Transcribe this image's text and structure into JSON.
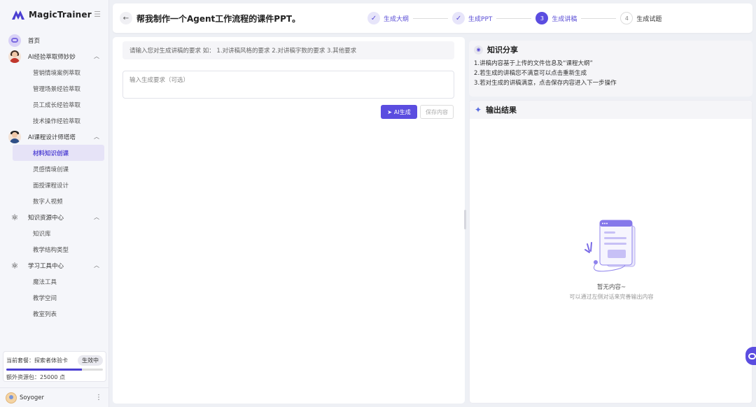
{
  "app": {
    "name": "MagicTrainer"
  },
  "sidebar": {
    "home": "首页",
    "groups": [
      {
        "label": "AI经验萃取师妙妙",
        "items": [
          "营销情境案例萃取",
          "管理场景经验萃取",
          "员工成长经验萃取",
          "技术操作经验萃取"
        ]
      },
      {
        "label": "AI课程设计师塔塔",
        "items": [
          "材料知识创课",
          "灵感情境创课",
          "面授课程设计",
          "数字人视频"
        ]
      },
      {
        "label": "知识资源中心",
        "items": [
          "知识库",
          "教学结构类型"
        ]
      },
      {
        "label": "学习工具中心",
        "items": [
          "魔法工具",
          "教学空间",
          "教室列表"
        ]
      }
    ],
    "active_item": "材料知识创课",
    "plan": {
      "label": "当前套餐：探索者体验卡",
      "badge": "生效中",
      "progress": 0.78,
      "extra": "额外资源包：25000 点"
    },
    "user": {
      "name": "Soyoger"
    }
  },
  "header": {
    "title": "帮我制作一个Agent工作流程的课件PPT。",
    "steps": [
      {
        "index": "1",
        "label": "生成大纲",
        "state": "done"
      },
      {
        "index": "2",
        "label": "生成PPT",
        "state": "done"
      },
      {
        "index": "3",
        "label": "生成讲稿",
        "state": "current"
      },
      {
        "index": "4",
        "label": "生成试题",
        "state": "todo"
      }
    ]
  },
  "left": {
    "hint": "请输入您对生成讲稿的要求 如： 1.对讲稿风格的要求 2.对讲稿字数的要求 3.其他要求",
    "input_placeholder": "输入生成要求（可选）",
    "ai_button": "AI生成",
    "save_button": "保存内容"
  },
  "right": {
    "share_title": "知识分享",
    "share_lines": [
      "1.讲稿内容基于上传的文件信息及“课程大纲”",
      "2.若生成的讲稿您不满意可以点击重新生成",
      "3.若对生成的讲稿满意，点击保存内容进入下一步操作"
    ],
    "output_title": "输出结果",
    "empty_title": "暂无内容~",
    "empty_sub": "可以通过左侧对话来完善输出内容"
  },
  "colors": {
    "accent": "#5b4de0",
    "background": "#eef0f5"
  }
}
